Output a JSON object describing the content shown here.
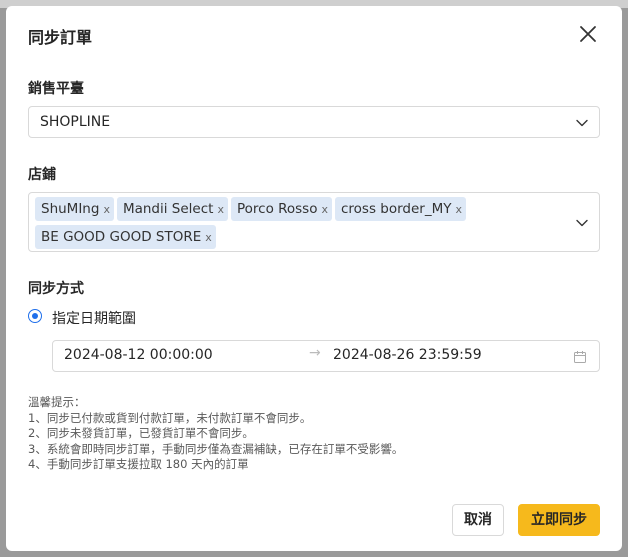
{
  "dialog": {
    "title": "同步訂單",
    "close_icon": "close-icon"
  },
  "platform": {
    "label": "銷售平臺",
    "value": "SHOPLINE",
    "icon": "chevron-down-icon"
  },
  "stores": {
    "label": "店鋪",
    "selected": [
      "ShuMIng",
      "Mandii Select",
      "Porco Rosso",
      "cross border_MY",
      "BE GOOD GOOD STORE"
    ],
    "remove_glyph": "x",
    "icon": "chevron-down-icon"
  },
  "sync_method": {
    "label": "同步方式",
    "option_label": "指定日期範圍",
    "option_selected": true
  },
  "date_range": {
    "start": "2024-08-12 00:00:00",
    "separator": "→",
    "end": "2024-08-26 23:59:59",
    "icon": "calendar-icon"
  },
  "notes": {
    "heading": "溫馨提示：",
    "items": [
      "1、同步已付款或貨到付款訂單，未付款訂單不會同步。",
      "2、同步未發貨訂單，已發貨訂單不會同步。",
      "3、系統會即時同步訂單，手動同步僅為查漏補缺，已存在訂單不受影響。",
      "4、手動同步訂單支援拉取 180 天內的訂單"
    ]
  },
  "actions": {
    "cancel_label": "取消",
    "sync_label": "立即同步"
  },
  "colors": {
    "primary": "#f6b91c",
    "radio": "#1f6feb",
    "tag_bg": "#dde8f6"
  }
}
